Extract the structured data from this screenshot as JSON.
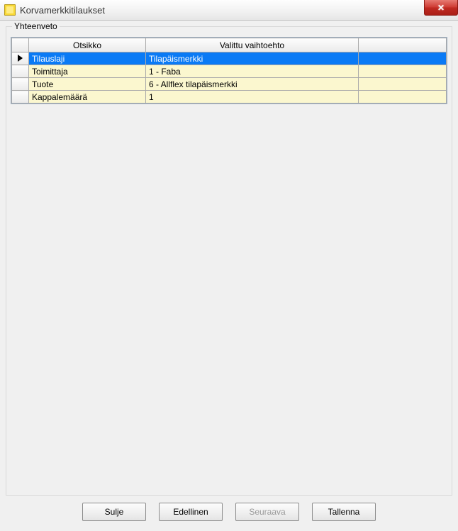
{
  "window": {
    "title": "Korvamerkkitilaukset"
  },
  "fieldset": {
    "legend": "Yhteenveto"
  },
  "grid": {
    "columns": {
      "selector": "",
      "otsikko": "Otsikko",
      "valittu": "Valittu vaihtoehto",
      "trailing": ""
    },
    "rows": [
      {
        "otsikko": "Tilauslaji",
        "valittu": "Tilapäismerkki",
        "selected": true
      },
      {
        "otsikko": "Toimittaja",
        "valittu": "1 - Faba",
        "selected": false
      },
      {
        "otsikko": "Tuote",
        "valittu": "6 - Allflex tilapäismerkki",
        "selected": false
      },
      {
        "otsikko": "Kappalemäärä",
        "valittu": "1",
        "selected": false
      }
    ]
  },
  "buttons": {
    "close": "Sulje",
    "prev": "Edellinen",
    "next": "Seuraava",
    "save": "Tallenna"
  }
}
